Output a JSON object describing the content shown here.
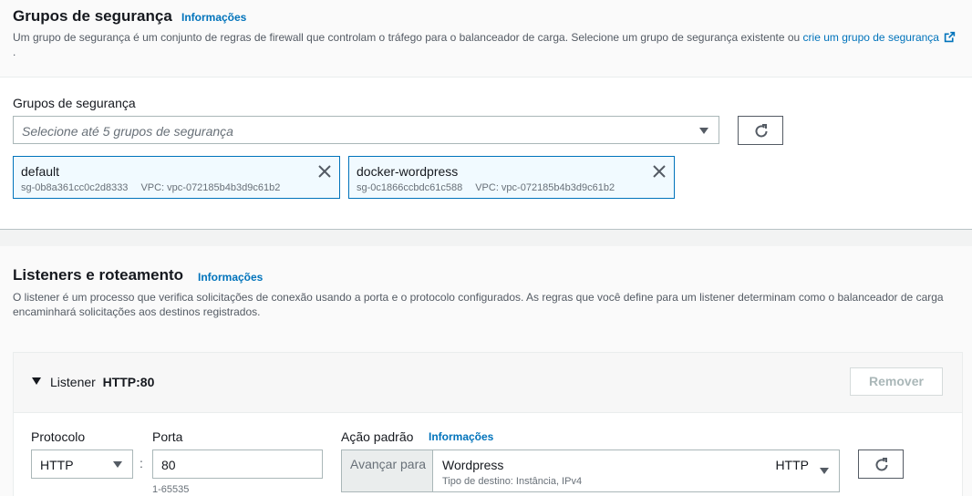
{
  "security_groups": {
    "title": "Grupos de segurança",
    "info_link": "Informações",
    "description_text": "Um grupo de segurança é um conjunto de regras de firewall que controlam o tráfego para o balanceador de carga. Selecione um grupo de segurança existente ou",
    "description_link_line1": "crie um grupo de",
    "description_link_line2": "segurança",
    "field_label": "Grupos de segurança",
    "placeholder": "Selecione até 5 grupos de segurança",
    "selected": [
      {
        "name": "default",
        "id": "sg-0b8a361cc0c2d8333",
        "vpc": "VPC: vpc-072185b4b3d9c61b2"
      },
      {
        "name": "docker-wordpress",
        "id": "sg-0c1866ccbdc61c588",
        "vpc": "VPC: vpc-072185b4b3d9c61b2"
      }
    ]
  },
  "listeners": {
    "title": "Listeners e roteamento",
    "info_link": "Informações",
    "description_line1": "O listener é um processo que verifica solicitações de conexão usando a porta e o protocolo configurados. As regras que você define para um listener determinam como o balanceador de carga",
    "description_line2": "encaminhará solicitações aos destinos registrados.",
    "listener": {
      "label": "Listener",
      "name": "HTTP:80",
      "remove_button": "Remover",
      "protocol_label": "Protocolo",
      "protocol_value": "HTTP",
      "separator": ":",
      "port_label": "Porta",
      "port_value": "80",
      "port_hint": "1-65535",
      "default_action_label": "Ação padrão",
      "default_action_info": "Informações",
      "forward_to_label": "Avançar para",
      "target_name": "Wordpress",
      "target_protocol": "HTTP",
      "target_type": "Tipo de destino: Instância, IPv4"
    }
  },
  "colors": {
    "link": "#0073bb",
    "token_border": "#0073bb",
    "token_bg": "#f1faff"
  }
}
